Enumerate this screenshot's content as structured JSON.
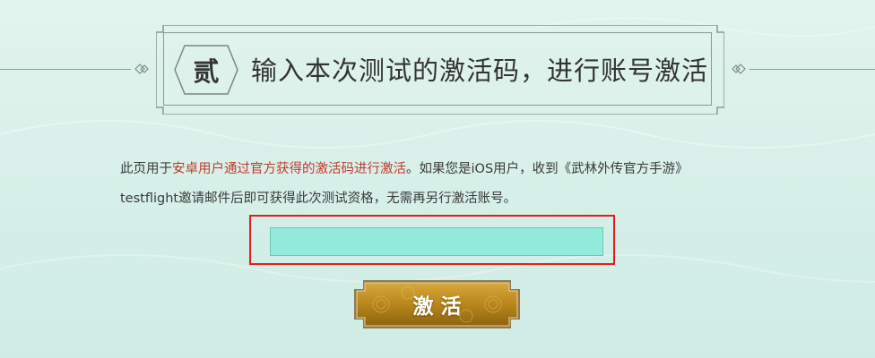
{
  "header": {
    "step_badge": "贰",
    "title": "输入本次测试的激活码，进行账号激活"
  },
  "description": {
    "part1": "此页用于",
    "highlight": "安卓用户通过官方获得的激活码进行激活",
    "part2": "。如果您是iOS用户，收到《武林外传官方手游》",
    "line2": "testflight邀请邮件后即可获得此次测试资格，无需再另行激活账号。"
  },
  "activation_input": {
    "value": "",
    "placeholder": ""
  },
  "activate_button": {
    "label": "激活"
  },
  "colors": {
    "background": "#d6efe8",
    "highlight_text": "#c0392b",
    "input_fill": "#93ebdb",
    "annotation_box": "#e51d1d",
    "button_gold": "#b8861c"
  }
}
